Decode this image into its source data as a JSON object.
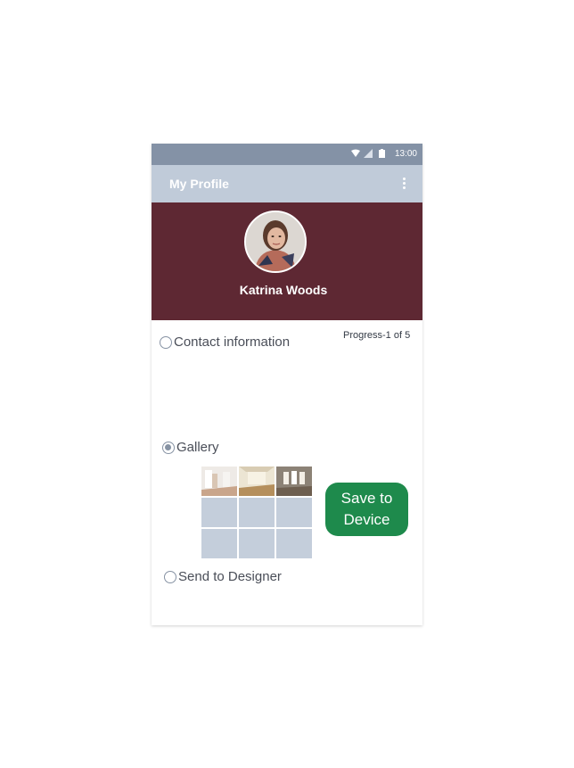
{
  "status_bar": {
    "time": "13:00",
    "icons": [
      "wifi-icon",
      "signal-icon",
      "battery-icon"
    ]
  },
  "app_bar": {
    "title": "My Profile",
    "menu_icon": "more-vertical-icon"
  },
  "profile": {
    "name": "Katrina Woods"
  },
  "progress_text": "Progress-1 of 5",
  "steps": [
    {
      "label": "Contact information",
      "checked": false
    },
    {
      "label": "Gallery",
      "checked": true
    },
    {
      "label": "Send to Designer",
      "checked": false
    }
  ],
  "gallery": {
    "filled_count": 3,
    "total_cells": 9
  },
  "save_button": {
    "label": "Save to\nDevice"
  },
  "colors": {
    "status_bar": "#8492a6",
    "app_bar": "#c0cbd9",
    "header": "#5e2833",
    "accent_button": "#1e8a4c",
    "empty_cell": "#c4cedb"
  }
}
